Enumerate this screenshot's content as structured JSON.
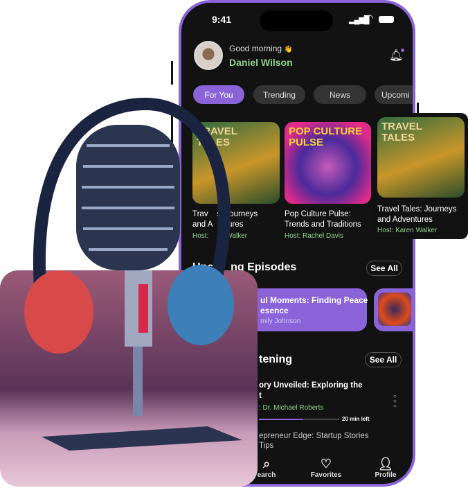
{
  "status": {
    "time": "9:41"
  },
  "greeting": {
    "text": "Good morning",
    "emoji": "👋",
    "name": "Daniel Wilson"
  },
  "tabs": [
    {
      "label": "For You",
      "active": true
    },
    {
      "label": "Trending"
    },
    {
      "label": "News"
    },
    {
      "label": "Upcomi"
    }
  ],
  "featured": [
    {
      "cover": "TRAVEL TALES",
      "title_line1": "Trav    s: Journeys",
      "title_line2": "and A      tures",
      "host": "Host:         Walker"
    },
    {
      "cover": "POP CULTURE PULSE",
      "title_line1": "Pop Culture Pulse:",
      "title_line2": "Trends and Traditions",
      "host": "Host: Rachel Davis"
    },
    {
      "cover": "TRAVEL TALES",
      "title_line1": "Travel Tales: Journeys",
      "title_line2": "and Adventures",
      "host": "Host: Karen Walker"
    }
  ],
  "upcoming": {
    "title": "Upcor  ng Episodes",
    "see_all": "See All",
    "card": {
      "line1": "ul Moments: Finding Peace",
      "line2": "esence",
      "host": "mily Johnson"
    }
  },
  "continue": {
    "title": "tening",
    "see_all": "See All",
    "items": [
      {
        "line1": "ory Unveiled: Exploring the",
        "line2": "t",
        "host": ": Dr. Michael Roberts",
        "progress": 0.55,
        "remaining": "20 min left"
      },
      {
        "line1": "epreneur Edge: Startup Stories",
        "line2": "Tips"
      }
    ]
  },
  "nav": [
    {
      "label": "earch",
      "icon": "search-icon"
    },
    {
      "label": "Favorites",
      "icon": "heart-icon"
    },
    {
      "label": "Profile",
      "icon": "user-icon"
    }
  ],
  "colors": {
    "accent": "#8a63d9",
    "host": "#8fd18a",
    "bg": "#121212"
  }
}
